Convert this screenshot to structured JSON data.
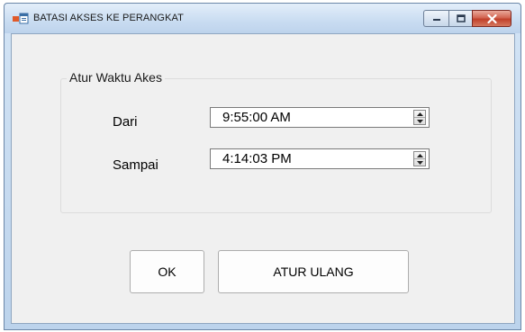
{
  "window": {
    "title": "BATASI AKSES KE PERANGKAT",
    "icons": {
      "app": "form-app-icon",
      "minimize": "minimize-icon",
      "maximize": "maximize-icon",
      "close": "close-icon"
    }
  },
  "group": {
    "title": "Atur Waktu Akes"
  },
  "from": {
    "label": "Dari",
    "value": "9:55:00 AM"
  },
  "to": {
    "label": "Sampai",
    "value": "4:14:03 PM"
  },
  "buttons": {
    "ok": "OK",
    "reset": "ATUR ULANG"
  },
  "colors": {
    "close_button": "#c1402a",
    "titlebar": "#c9dcf1",
    "client_background": "#f0f0f0"
  }
}
